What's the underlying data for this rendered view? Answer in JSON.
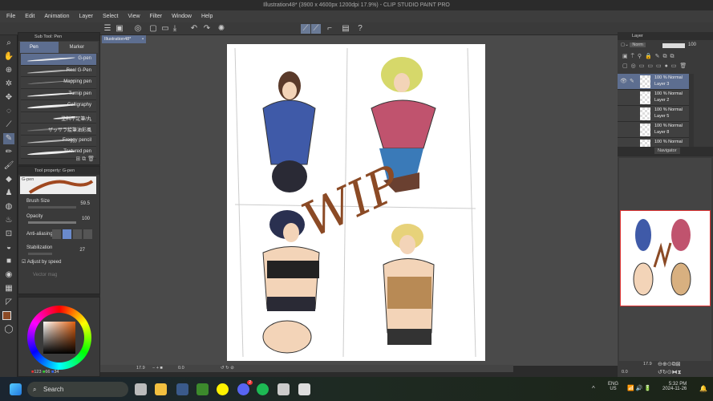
{
  "window": {
    "title": "Illustration48* (3900 x 4600px 1200dpi 17.9%)  - CLIP STUDIO PAINT PRO"
  },
  "menu": [
    "File",
    "Edit",
    "Animation",
    "Layer",
    "Select",
    "View",
    "Filter",
    "Window",
    "Help"
  ],
  "document_tab": "Illustration48*",
  "subtool": {
    "header": "Sub Tool: Pen",
    "tabs": [
      "Pen",
      "Marker"
    ],
    "brushes": [
      "G-pen",
      "Real G-Pen",
      "Mapping pen",
      "Turnip pen",
      "Calligraphy",
      "塗料不足筆/丸",
      "ザッサラ絵筆油彩風",
      "Froggy pencil",
      "Textured pen"
    ]
  },
  "tool_property": {
    "header": "Tool property: G-pen",
    "preview_label": "G-pen",
    "brush_size_label": "Brush Size",
    "brush_size": "59.5",
    "opacity_label": "Opacity",
    "opacity": "100",
    "antialiasing_label": "Anti-aliasing",
    "stabilization_label": "Stabilization",
    "stabilization": "27",
    "adjust_speed_label": "Adjust by speed",
    "vector_magnet_label": "Vector mag"
  },
  "color": {
    "main": "#8b4a25",
    "r": "123",
    "g": "66",
    "b": "34"
  },
  "layers": {
    "tab": "Layer",
    "blend": "Norm",
    "opacity": "100",
    "items": [
      {
        "mode": "100 % Normal",
        "name": "Layer 3"
      },
      {
        "mode": "100 % Normal",
        "name": "Layer 2"
      },
      {
        "mode": "100 % Normal",
        "name": "Layer 5"
      },
      {
        "mode": "100 % Normal",
        "name": "Layer 8"
      },
      {
        "mode": "100 % Normal",
        "name": ""
      }
    ]
  },
  "navigator": {
    "tab": "Navigator",
    "zoom": "17.9",
    "rotation": "0.0"
  },
  "statusbar": {
    "zoom": "17.9",
    "rotation": "0.0"
  },
  "artwork": {
    "text": "WIP"
  },
  "taskbar": {
    "search_placeholder": "Search",
    "discord_badge": "2",
    "lang": "ENG",
    "region": "US",
    "time": "5:32 PM",
    "date": "2024-11-26"
  }
}
